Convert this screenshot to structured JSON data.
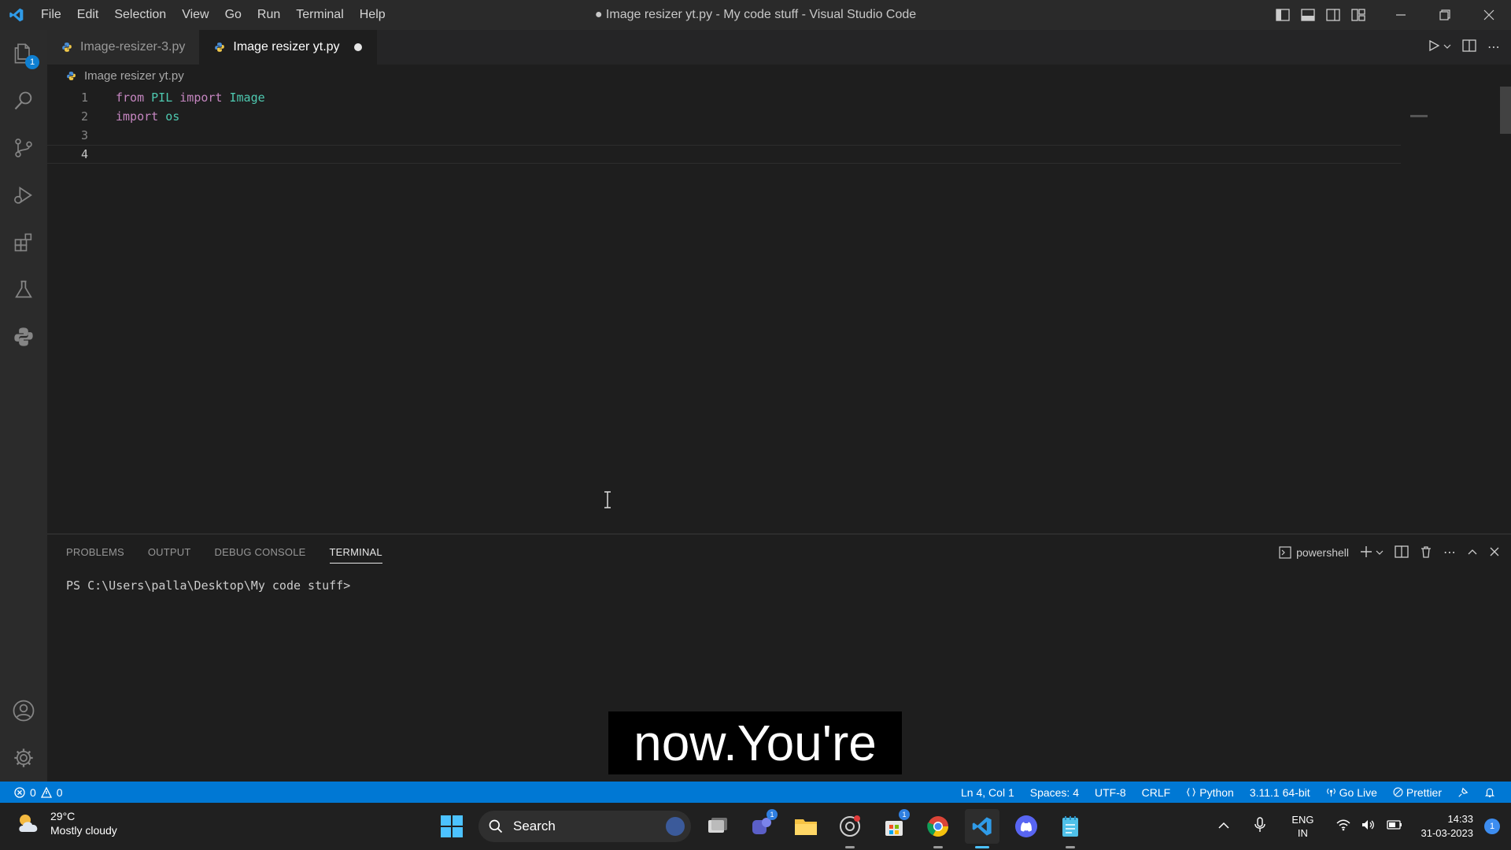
{
  "window": {
    "title": "● Image resizer yt.py - My code stuff - Visual Studio Code",
    "menu": [
      "File",
      "Edit",
      "Selection",
      "View",
      "Go",
      "Run",
      "Terminal",
      "Help"
    ]
  },
  "activity_bar": {
    "explorer_badge": "1",
    "items": [
      "files-icon",
      "search-icon",
      "source-control-icon",
      "run-debug-icon",
      "extensions-icon",
      "testing-icon",
      "python-icon"
    ],
    "bottom": [
      "account-icon",
      "settings-gear-icon"
    ]
  },
  "tabs": [
    {
      "label": "Image-resizer-3.py",
      "active": false
    },
    {
      "label": "Image resizer yt.py",
      "active": true,
      "modified": true
    }
  ],
  "breadcrumb": "Image resizer yt.py",
  "code": {
    "line_numbers": [
      "1",
      "2",
      "3",
      "4"
    ],
    "lines": [
      [
        {
          "t": "from",
          "c": "kw"
        },
        {
          "t": " PIL ",
          "c": "mod"
        },
        {
          "t": "import",
          "c": "kw"
        },
        {
          "t": " Image",
          "c": "mod"
        }
      ],
      [
        {
          "t": "import",
          "c": "kw"
        },
        {
          "t": " os",
          "c": "mod"
        }
      ],
      [],
      []
    ]
  },
  "panel": {
    "tabs": [
      "PROBLEMS",
      "OUTPUT",
      "DEBUG CONSOLE",
      "TERMINAL"
    ],
    "active_tab": "TERMINAL",
    "shell": "powershell",
    "prompt": "PS C:\\Users\\palla\\Desktop\\My code stuff>"
  },
  "subtitle": "now.You're",
  "statusbar": {
    "errors": "0",
    "warnings": "0",
    "position": "Ln 4, Col 1",
    "spaces": "Spaces: 4",
    "encoding": "UTF-8",
    "eol": "CRLF",
    "language": "Python",
    "interpreter": "3.11.1 64-bit",
    "go_live": "Go Live",
    "prettier": "Prettier"
  },
  "taskbar": {
    "temperature": "29°C",
    "weather": "Mostly cloudy",
    "search_label": "Search",
    "lang_line1": "ENG",
    "lang_line2": "IN",
    "time": "14:33",
    "date": "31-03-2023",
    "notification_count": "1",
    "teams_badge": "1",
    "store_badge": "1"
  },
  "colors": {
    "accent": "#0078d4",
    "keyword": "#c586c0",
    "module": "#4ec9b0"
  }
}
